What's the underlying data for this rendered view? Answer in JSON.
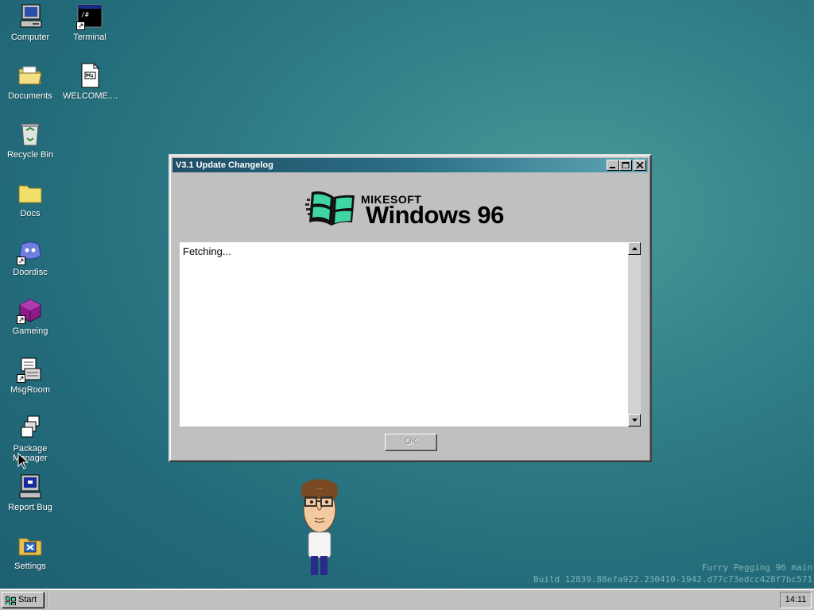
{
  "desktop": {
    "icons": [
      {
        "label": "Computer",
        "icon": "computer-icon"
      },
      {
        "label": "Terminal",
        "icon": "terminal-icon"
      },
      {
        "label": "Documents",
        "icon": "folder-open-icon"
      },
      {
        "label": "WELCOME....",
        "icon": "markdown-file-icon"
      },
      {
        "label": "Recycle Bin",
        "icon": "recycle-bin-icon"
      },
      {
        "label": "Docs",
        "icon": "folder-icon"
      },
      {
        "label": "Doordisc",
        "icon": "doordisc-icon"
      },
      {
        "label": "Gameing",
        "icon": "game-cube-icon"
      },
      {
        "label": "MsgRoom",
        "icon": "msgroom-icon"
      },
      {
        "label": "Package Manager",
        "icon": "package-icon"
      },
      {
        "label": "Report Bug",
        "icon": "report-bug-icon"
      },
      {
        "label": "Settings",
        "icon": "settings-icon"
      }
    ]
  },
  "window": {
    "title": "V3.1 Update Changelog",
    "logo": {
      "brand": "MIKESOFT",
      "product": "Windows 96"
    },
    "content_text": "Fetching...",
    "ok_label": "OK"
  },
  "watermark": {
    "line1": "Furry Pegging 96 main",
    "line2": "Build 12839.88efa922.230410-1942.d77c73edcc428f7bc571"
  },
  "taskbar": {
    "start_label": "Start",
    "clock": "14:11"
  },
  "colors": {
    "desktop": "#2f7d86",
    "titlebar_start": "#1e4f66",
    "titlebar_end": "#5fa6b6",
    "logo_green": "#3fd6a3"
  }
}
